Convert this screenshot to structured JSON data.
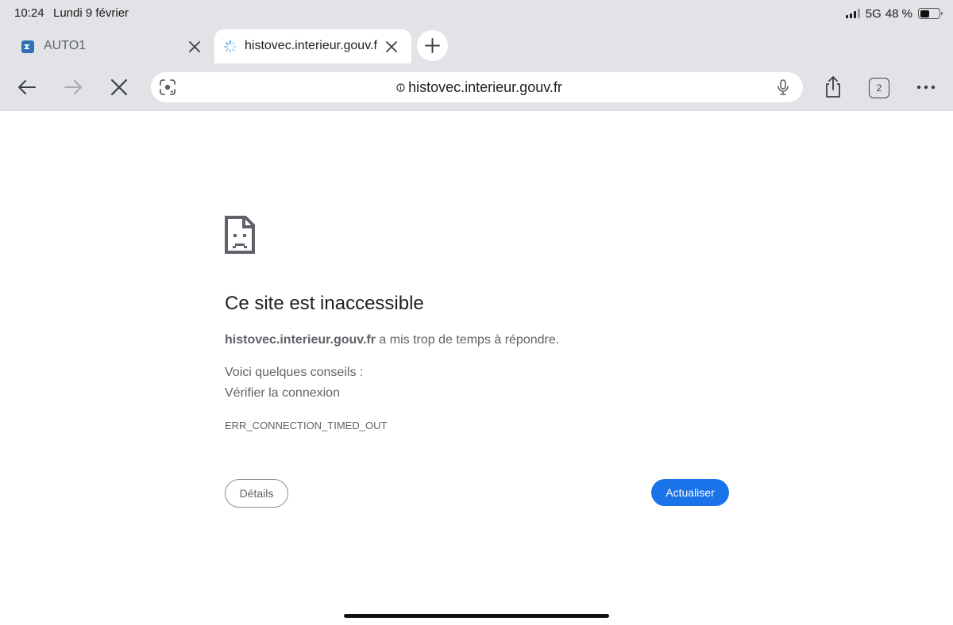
{
  "status_bar": {
    "time": "10:24",
    "date": "Lundi 9 février",
    "network": "5G",
    "battery_text": "48 %",
    "battery_level": 0.48
  },
  "tabs": [
    {
      "title": "AUTO1",
      "favicon": "auto1-logo-icon",
      "active": false
    },
    {
      "title": "histovec.interieur.gouv.fr",
      "favicon": "loading-spinner-icon",
      "active": true
    }
  ],
  "toolbar": {
    "url": "histovec.interieur.gouv.fr",
    "tab_count": "2"
  },
  "error": {
    "icon": "sad-page-icon",
    "title": "Ce site est inaccessible",
    "host": "histovec.interieur.gouv.fr",
    "message": " a mis trop de temps à répondre.",
    "tips_heading": "Voici quelques conseils :",
    "tip": "Vérifier la connexion",
    "code": "ERR_CONNECTION_TIMED_OUT",
    "details_label": "Détails",
    "reload_label": "Actualiser"
  },
  "colors": {
    "chrome_background": "#e2e3e6",
    "accent": "#1a73e8",
    "text_primary": "#202124",
    "text_secondary": "#5f6368"
  }
}
